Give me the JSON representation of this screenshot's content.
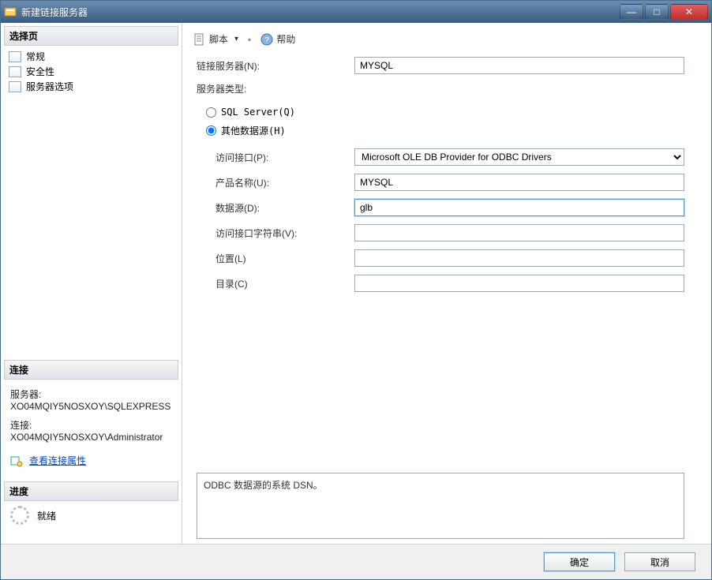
{
  "window": {
    "title": "新建链接服务器"
  },
  "sidebar": {
    "header": "选择页",
    "items": [
      {
        "label": "常规"
      },
      {
        "label": "安全性"
      },
      {
        "label": "服务器选项"
      }
    ],
    "connection_header": "连接",
    "server_label": "服务器:",
    "server_value": "XO04MQIY5NOSXOY\\SQLEXPRESS",
    "conn_label": "连接:",
    "conn_value": "XO04MQIY5NOSXOY\\Administrator",
    "view_props": "查看连接属性",
    "progress_header": "进度",
    "progress_status": "就绪"
  },
  "toolbar": {
    "script": "脚本",
    "help": "帮助"
  },
  "form": {
    "linked_server_label": "链接服务器(N):",
    "linked_server_value": "MYSQL",
    "server_type_label": "服务器类型:",
    "radio_sql": "SQL Server(Q)",
    "radio_other": "其他数据源(H)",
    "provider_label": "访问接口(P):",
    "provider_value": "Microsoft OLE DB Provider for ODBC Drivers",
    "product_label": "产品名称(U):",
    "product_value": "MYSQL",
    "datasource_label": "数据源(D):",
    "datasource_value": "glb",
    "provstring_label": "访问接口字符串(V):",
    "provstring_value": "",
    "location_label": "位置(L)",
    "location_value": "",
    "catalog_label": "目录(C)",
    "catalog_value": "",
    "hint": "ODBC 数据源的系统 DSN。"
  },
  "footer": {
    "ok": "确定",
    "cancel": "取消"
  }
}
